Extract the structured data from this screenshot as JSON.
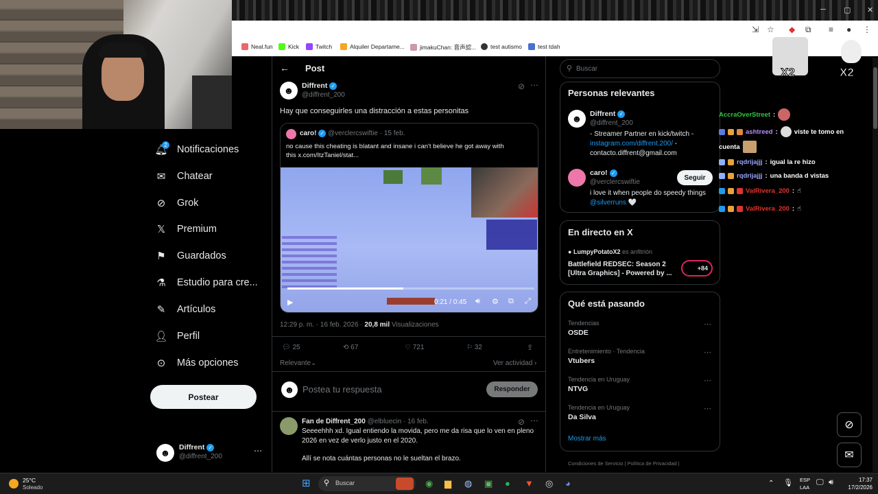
{
  "browser": {
    "bookmarks": [
      "Neal.fun",
      "Kick",
      "Twitch",
      "Alquiler Departame...",
      "jimakuChan: 音声認...",
      "test autismo",
      "test tdah"
    ]
  },
  "nav": {
    "items": [
      "Notificaciones",
      "Chatear",
      "Grok",
      "Premium",
      "Guardados",
      "Estudio para cre...",
      "Artículos",
      "Perfil",
      "Más opciones"
    ],
    "notif_count": "2",
    "post_label": "Postear",
    "user_name": "Diffrent",
    "user_handle": "@diffrent_200"
  },
  "post": {
    "header": "Post",
    "author": "Diffrent",
    "handle": "@diffrent_200",
    "text": "Hay que conseguirles una distracción a estas personitas",
    "quote": {
      "author": "caro!",
      "handle": "@verclercswiftie",
      "date": "· 15 feb.",
      "text_line1": "no cause this cheating is blatant and insane i can't believe he got away with",
      "text_line2": "this  x.com/ItzTaniel/stat...",
      "video_time": "0:21 / 0:45"
    },
    "meta_time": "12:29 p. m. · 16 feb. 2026 ·",
    "views_count": "20,8 mil",
    "views_label": "Visualizaciones",
    "replies": "25",
    "reposts": "67",
    "likes": "721",
    "bookmarks": "32",
    "sort_label": "Relevante",
    "activity_label": "Ver actividad",
    "reply_placeholder": "Postea tu respuesta",
    "reply_button": "Responder"
  },
  "comment": {
    "author": "Fan de Diffrent_200",
    "handle": "@elbluecin",
    "date": "· 16 feb.",
    "line1": "Seeeehhh xd. Igual entiendo la movida, pero me da risa que lo ven en pleno",
    "line2": "2026 en vez de verlo justo en el 2020.",
    "line3": "Allí se nota cuántas personas no le sueltan el brazo."
  },
  "search": {
    "placeholder": "Buscar"
  },
  "relevant": {
    "title": "Personas relevantes",
    "p1_name": "Diffrent",
    "p1_handle": "@diffrent_200",
    "p1_bio1": "- Streamer Partner en kick/twitch -",
    "p1_link": "instagram.com/diffrent.200/",
    "p1_bio2": "-",
    "p1_bio3": "contacto.diffrent@gmail.com",
    "p2_name": "caro!",
    "p2_handle": "@verclercswiftie",
    "p2_bio": "i love it when people do speedy things",
    "p2_mention": "@silverruns",
    "p2_heart": "🤍",
    "follow": "Seguir"
  },
  "live": {
    "title": "En directo en X",
    "host": "LumpyPotatoX2",
    "host_role": "es anfitrión",
    "stream_title1": "Battlefield REDSEC: Season 2",
    "stream_title2": "[Ultra Graphics] - Powered by ...",
    "listeners": "+84"
  },
  "trends": {
    "title": "Qué está pasando",
    "items": [
      {
        "context": "Tendencias",
        "name": "OSDE"
      },
      {
        "context": "Entretenimiento · Tendencia",
        "name": "Vtubers"
      },
      {
        "context": "Tendencia en Uruguay",
        "name": "NTVG"
      },
      {
        "context": "Tendencia en Uruguay",
        "name": "Da Silva"
      }
    ],
    "more": "Mostrar más"
  },
  "footer": {
    "terms": "Condiciones de Servicio",
    "privacy": "Política de Privacidad"
  },
  "overlay": {
    "x2a": "X2",
    "x2b": "X2"
  },
  "chat": [
    {
      "user": "AccraOverStreet",
      "msg": "",
      "color": "#2ecc40"
    },
    {
      "user": "ashtreed",
      "msg": "viste te tomo en",
      "color": "#b78cff"
    },
    {
      "user": "",
      "msg": "cuenta",
      "color": "#fff"
    },
    {
      "user": "rqdrijajjj",
      "msg": "igual la re hizo",
      "color": "#9aa4ff"
    },
    {
      "user": "rqdrijajjj",
      "msg": "una banda d vistas",
      "color": "#9aa4ff"
    },
    {
      "user": "ValRivera_200",
      "msg": "",
      "color": "#e0342c"
    },
    {
      "user": "ValRivera_200",
      "msg": "",
      "color": "#e0342c"
    }
  ],
  "taskbar": {
    "temp": "25°C",
    "weather": "Soleado",
    "search": "Buscar",
    "lang1": "ESP",
    "lang2": "LAA",
    "time": "17:37",
    "date": "17/2/2026"
  },
  "colors": {
    "accent": "#1d9bf0",
    "background": "#000000",
    "border": "#2f3336"
  }
}
